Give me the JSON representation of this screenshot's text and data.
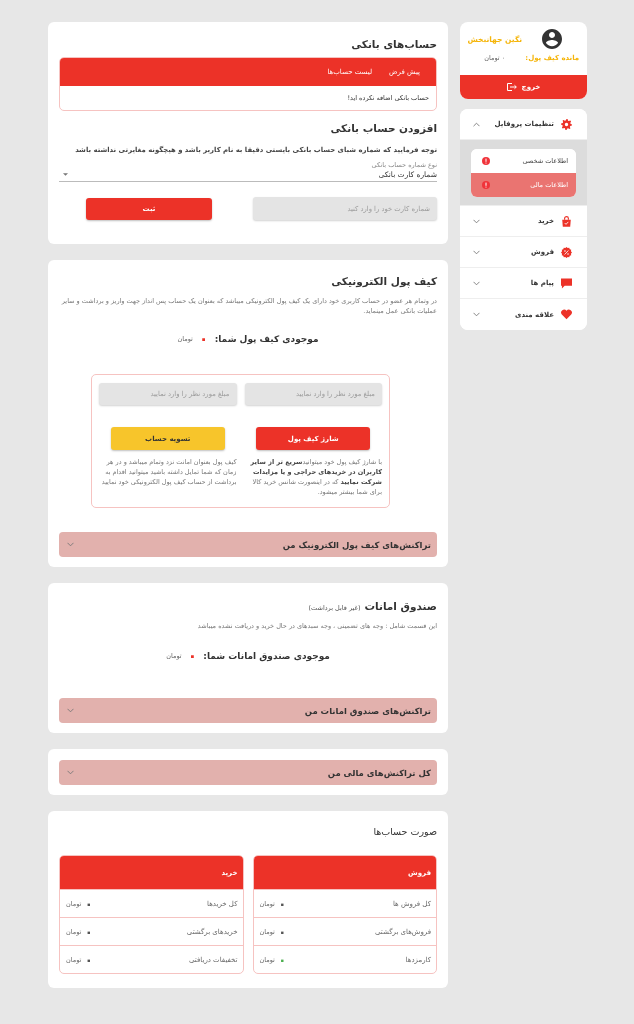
{
  "sidebar": {
    "profile": {
      "name": "نگین جهانبخش",
      "balance_label": "مانده کیف پول:",
      "balance": "۰ تومان",
      "logout": "خروج"
    },
    "menu": [
      {
        "label": "تنظیمات پروفایل",
        "expanded": true,
        "children": [
          {
            "label": "اطلاعات شخصی",
            "selected": false
          },
          {
            "label": "اطلاعات مالی",
            "selected": true
          }
        ]
      },
      {
        "label": "خرید",
        "expanded": false
      },
      {
        "label": "فروش",
        "expanded": false
      },
      {
        "label": "پیام ها",
        "expanded": false
      },
      {
        "label": "علاقه مندی",
        "expanded": false
      }
    ]
  },
  "bank_accounts": {
    "title": "حساب‌های بانکی",
    "columns": [
      "پیش فرض",
      "لیست حساب‌ها"
    ],
    "empty_message": "حساب بانکی اضافه نکرده اید!"
  },
  "add_account": {
    "title": "افزودن حساب بانکی",
    "note": "توجه فرمایید که شماره شبای حساب بانکی بایستی دقیقا به نام کاربر باشد و هیچگونه مغایرتی نداشته باشد",
    "account_type": {
      "label": "نوع شماره حساب بانکی",
      "value": "شماره کارت بانکی"
    },
    "card_number": {
      "placeholder": "شماره کارت خود را وارد کنید"
    },
    "submit": "ثبت"
  },
  "wallet": {
    "title": "کیف پول الکترونیکی",
    "description": "در وتمام هر عضو در حساب کاربری خود دارای یک کیف پول الکترونیکی میباشد که بعنوان یک حساب پس انداز جهت واریز و برداشت و سایر عملیات بانکی عمل مینماید.",
    "balance": {
      "label": "موجودی کیف پول شما:",
      "amount": "۰",
      "unit": "تومان"
    },
    "charge": {
      "amount": {
        "placeholder": "مبلغ مورد نظر را وارد نمایید"
      },
      "button": "شارژ کیف پول",
      "text": "با شارژ کیف پول خود میتوانید**سریع تر از سایر کاربران در خریدهای حراجی و یا مزایدات شرکت نمایید** که در اینصورت شانس خرید کالا برای شما بیشتر میشود."
    },
    "settle": {
      "amount": {
        "placeholder": "مبلغ مورد نظر را وارد نمایید"
      },
      "button": "تسویه حساب",
      "text": "کیف پول بعنوان امانت نزد وتمام میباشد و در هر زمان که شما تمایل داشته باشید میتوانید اقدام به برداشت از حساب کیف پول الکترونیکی خود نمایید"
    },
    "transactions": {
      "label": "تراکنش‌های کیف پول الکترونیک من",
      "expanded": false
    }
  },
  "escrow": {
    "title": "صندوق امانات",
    "subtitle": "(غیر قابل برداشت)",
    "description": "این قسمت شامل : وجه های تضمینی ، وجه سبدهای در حال خرید و دریافت نشده میباشد",
    "balance": {
      "label": "موجودی صندوق امانات شما:",
      "amount": "۰",
      "unit": "تومان"
    },
    "transactions": {
      "label": "تراکنش‌های صندوق امانات من",
      "expanded": false
    }
  },
  "all_transactions": {
    "label": "کل تراکنش‌های مالی من",
    "expanded": false
  },
  "statements": {
    "title": "صورت حساب‌ها",
    "tables": [
      {
        "title": "فروش",
        "rows": [
          {
            "label": "کل فروش ها",
            "amount": "۰",
            "unit": "تومان",
            "color": "#555555"
          },
          {
            "label": "فروش‌های برگشتی",
            "amount": "۰",
            "unit": "تومان",
            "color": "#555555"
          },
          {
            "label": "کارمزدها",
            "amount": "۰",
            "unit": "تومان",
            "color": "#4caf50"
          }
        ]
      },
      {
        "title": "خرید",
        "rows": [
          {
            "label": "کل خریدها",
            "amount": "۰",
            "unit": "تومان",
            "color": "#555555"
          },
          {
            "label": "خریدهای برگشتی",
            "amount": "۰",
            "unit": "تومان",
            "color": "#555555"
          },
          {
            "label": "تخفیفات دریافتی",
            "amount": "۰",
            "unit": "تومان",
            "color": "#555555"
          }
        ]
      }
    ]
  }
}
